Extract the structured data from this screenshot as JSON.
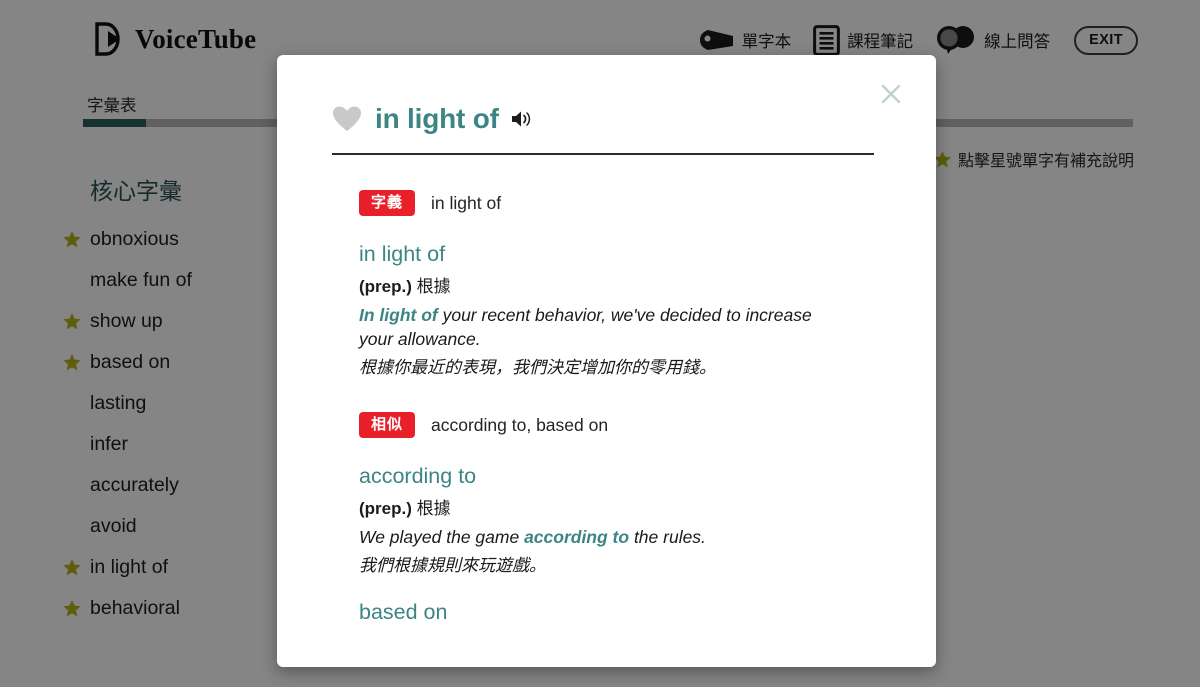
{
  "header": {
    "logo_text": "VoiceTube",
    "logo_icon": "voicetube-play-logo",
    "nav": [
      {
        "label": "單字本",
        "icon": "bookmark-tag-icon"
      },
      {
        "label": "課程筆記",
        "icon": "notebook-lines-icon"
      },
      {
        "label": "線上問答",
        "icon": "speech-bubbles-icon"
      }
    ],
    "exit_label": "EXIT"
  },
  "tabs": {
    "active_label": "字彙表",
    "progress_percent": 6
  },
  "hint": {
    "icon": "star-icon",
    "text": "點擊星號單字有補充說明"
  },
  "sidebar": {
    "heading": "核心字彙",
    "items": [
      {
        "label": "obnoxious",
        "starred": true
      },
      {
        "label": "make fun of",
        "starred": false
      },
      {
        "label": "show up",
        "starred": true
      },
      {
        "label": "based on",
        "starred": true
      },
      {
        "label": "lasting",
        "starred": false
      },
      {
        "label": "infer",
        "starred": false
      },
      {
        "label": "accurately",
        "starred": false
      },
      {
        "label": "avoid",
        "starred": false
      },
      {
        "label": "in light of",
        "starred": true
      },
      {
        "label": "behavioral",
        "starred": true
      }
    ]
  },
  "modal": {
    "favorite_icon": "heart-icon",
    "title": "in light of",
    "speaker_icon": "speaker-volume-icon",
    "close_icon": "close-x-icon",
    "sections": [
      {
        "badge": "字義",
        "badge_text": "in light of",
        "entries": [
          {
            "headword": "in light of",
            "pos": "(prep.)",
            "meaning": "根據",
            "example_pre": "",
            "example_hl": "In light of",
            "example_post": " your recent behavior, we've decided to increase your allowance.",
            "translation": "根據你最近的表現，我們決定增加你的零用錢。"
          }
        ]
      },
      {
        "badge": "相似",
        "badge_text": "according to, based on",
        "entries": [
          {
            "headword": "according to",
            "pos": "(prep.)",
            "meaning": "根據",
            "example_pre": "We played the game ",
            "example_hl": "according to",
            "example_post": " the rules.",
            "translation": "我們根據規則來玩遊戲。"
          },
          {
            "headword": "based on",
            "pos": "",
            "meaning": "",
            "example_pre": "",
            "example_hl": "",
            "example_post": "",
            "translation": ""
          }
        ]
      }
    ]
  },
  "colors": {
    "teal": "#3d8585",
    "heading_teal": "#2d5454",
    "badge_red": "#e8202a",
    "star_olive": "#b5b518",
    "progress_fill": "#2d5e5e"
  }
}
